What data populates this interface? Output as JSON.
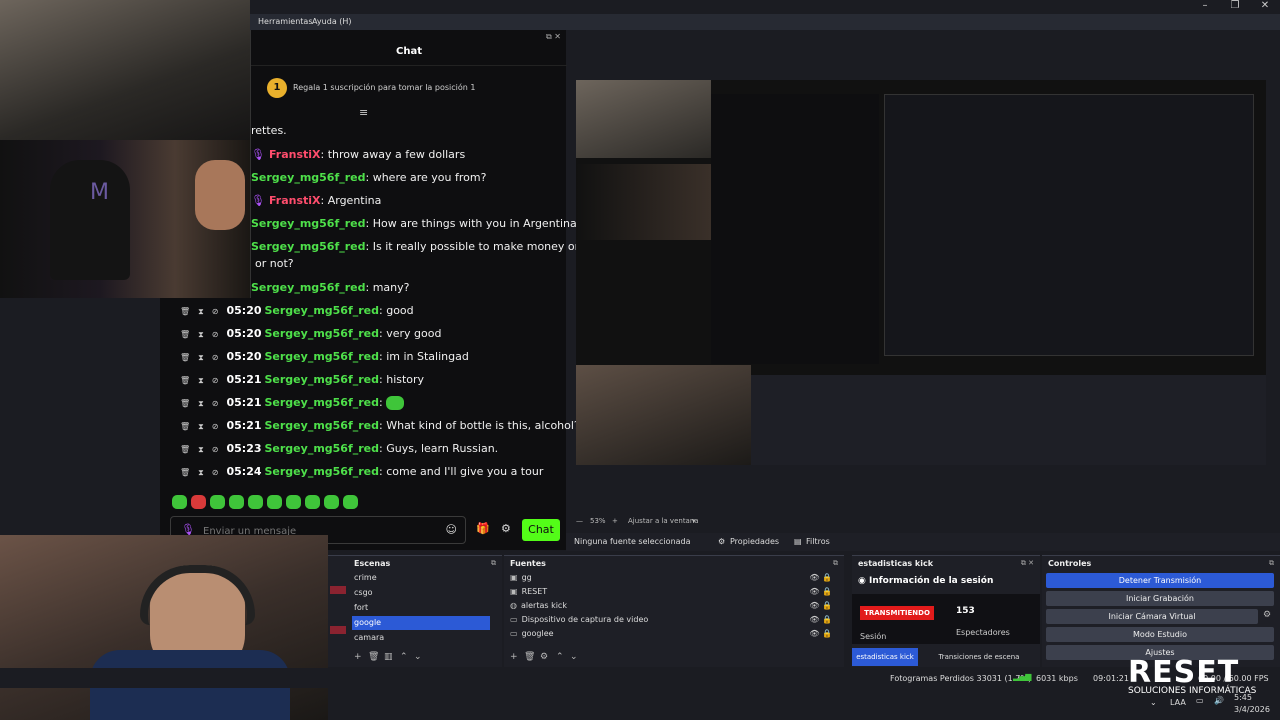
{
  "menu": {
    "tools": "Herramientas",
    "help": "Ayuda (H)"
  },
  "chat": {
    "title": "Chat",
    "sub_badge": "1",
    "sub_text": "Regala 1 suscripción para tomar la posición 1",
    "fragment": "rettes.",
    "messages": [
      {
        "user": "FranstiX",
        "user_color": "red",
        "text": "throw away a few dollars"
      },
      {
        "user": "Sergey_mg56f_red",
        "user_color": "green",
        "text": "where are you from?"
      },
      {
        "user": "FranstiX",
        "user_color": "red",
        "text": "Argentina"
      },
      {
        "user": "Sergey_mg56f_red",
        "user_color": "green",
        "text": "How are things with you in Argentina?"
      },
      {
        "user": "Sergey_mg56f_red",
        "user_color": "green",
        "text": "Is it really possible to make money on",
        "text2": "or not?"
      },
      {
        "user": "Sergey_mg56f_red",
        "user_color": "green",
        "text": "many?"
      }
    ],
    "mod_messages": [
      {
        "time": "05:20",
        "user": "Sergey_mg56f_red",
        "text": "good"
      },
      {
        "time": "05:20",
        "user": "Sergey_mg56f_red",
        "text": "very good"
      },
      {
        "time": "05:20",
        "user": "Sergey_mg56f_red",
        "text": "im in Stalingad"
      },
      {
        "time": "05:21",
        "user": "Sergey_mg56f_red",
        "text": "history"
      },
      {
        "time": "05:21",
        "user": "Sergey_mg56f_red",
        "text": ""
      },
      {
        "time": "05:21",
        "user": "Sergey_mg56f_red",
        "text": "What kind of bottle is this, alcohol?"
      },
      {
        "time": "05:23",
        "user": "Sergey_mg56f_red",
        "text": "Guys, learn Russian."
      },
      {
        "time": "05:24",
        "user": "Sergey_mg56f_red",
        "text": "come and I'll give you a tour"
      }
    ],
    "input_placeholder": "Enviar un mensaje",
    "send_label": "Chat"
  },
  "preview": {
    "zoom": "53%",
    "fit_label": "Ajustar a la ventana",
    "no_source": "Ninguna fuente seleccionada",
    "properties": "Propiedades",
    "filters": "Filtros"
  },
  "scenes": {
    "title": "Escenas",
    "items": [
      "crime",
      "csgo",
      "fort",
      "google",
      "camara"
    ],
    "selected": "google"
  },
  "sources": {
    "title": "Fuentes",
    "items": [
      "gg",
      "RESET",
      "alertas kick",
      "Dispositivo de captura de video",
      "googlee"
    ]
  },
  "stats": {
    "title": "estadisticas kick",
    "info_title": "Información de la sesión",
    "live_label": "TRANSMITIENDO",
    "viewers": "153",
    "viewers_label": "Espectadores",
    "session_label": "Sesión",
    "tab1": "estadisticas kick",
    "tab2": "Transiciones de escena"
  },
  "controls": {
    "title": "Controles",
    "stop": "Detener Transmisión",
    "record": "Iniciar Grabación",
    "vcam": "Iniciar Cámara Virtual",
    "studio": "Modo Estudio",
    "settings": "Ajustes"
  },
  "status": {
    "frames": "Fotogramas Perdidos 33031 (1.7%)",
    "bitrate": "6031 kbps",
    "time": "09:01:21",
    "fps": "60.00 / 60.00 FPS"
  },
  "taskbar": {
    "lang": "LAA",
    "clock": "5:45",
    "date": "3/4/2026"
  },
  "logo": {
    "main": "RESET",
    "sub": "SOLUCIONES INFORMÁTICAS"
  }
}
